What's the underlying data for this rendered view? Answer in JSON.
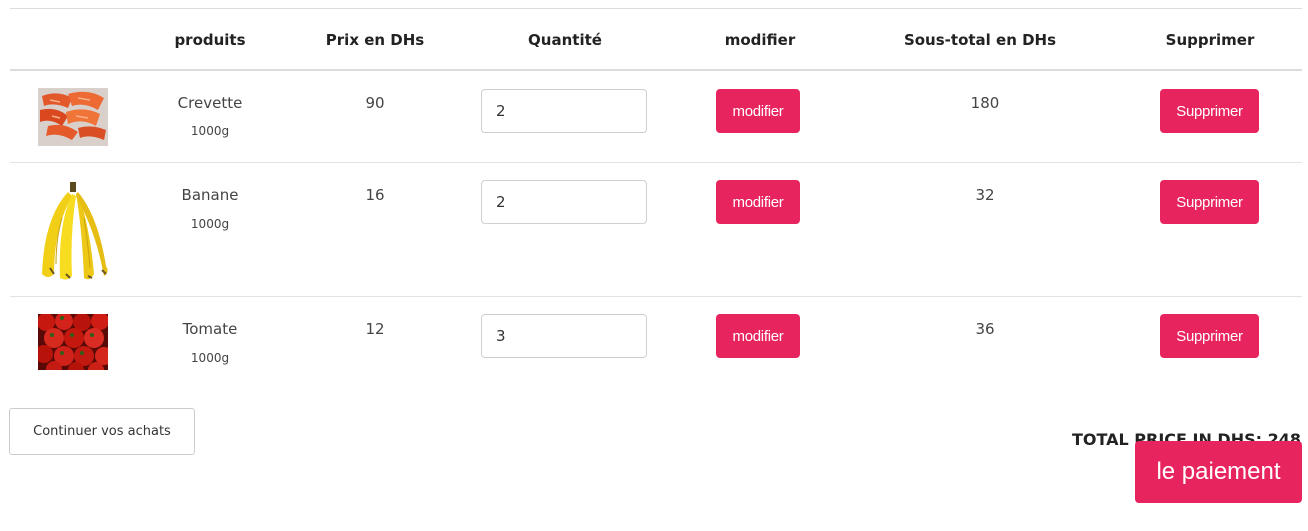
{
  "table": {
    "headers": {
      "image": "",
      "product": "produits",
      "price": "Prix en DHs",
      "quantity": "Quantité",
      "modify": "modifier",
      "subtotal": "Sous-total en DHs",
      "delete": "Supprimer"
    },
    "rows": [
      {
        "name": "Crevette",
        "weight": "1000g",
        "price": "90",
        "quantity": "2",
        "modify_label": "modifier",
        "subtotal": "180",
        "delete_label": "Supprimer",
        "image_icon": "shrimp-image"
      },
      {
        "name": "Banane",
        "weight": "1000g",
        "price": "16",
        "quantity": "2",
        "modify_label": "modifier",
        "subtotal": "32",
        "delete_label": "Supprimer",
        "image_icon": "banana-image"
      },
      {
        "name": "Tomate",
        "weight": "1000g",
        "price": "12",
        "quantity": "3",
        "modify_label": "modifier",
        "subtotal": "36",
        "delete_label": "Supprimer",
        "image_icon": "tomato-image"
      }
    ]
  },
  "footer": {
    "continue_label": "Continuer vos achats",
    "total_label": "TOTAL PRICE IN DHS: 248",
    "pay_label": "le paiement"
  },
  "colors": {
    "accent": "#e8245f",
    "border": "#dcdcdc"
  }
}
